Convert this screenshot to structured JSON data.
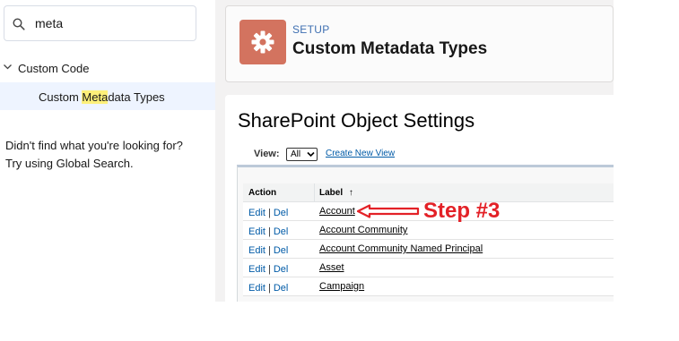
{
  "sidebar": {
    "search": {
      "value": "meta"
    },
    "tree": {
      "parent_label": "Custom Code",
      "child": {
        "before": "Custom ",
        "highlight": "Meta",
        "after": "data Types"
      }
    },
    "hint_line1": "Didn't find what you're looking for?",
    "hint_line2": "Try using Global Search."
  },
  "header": {
    "eyebrow": "SETUP",
    "title": "Custom Metadata Types"
  },
  "content": {
    "title": "SharePoint Object Settings",
    "view": {
      "label": "View:",
      "selected": "All",
      "create_link": "Create New View"
    },
    "table": {
      "headers": {
        "action": "Action",
        "label": "Label",
        "sort_glyph": "↑"
      },
      "rows": [
        {
          "edit": "Edit",
          "sep": "|",
          "del": "Del",
          "label": "Account"
        },
        {
          "edit": "Edit",
          "sep": "|",
          "del": "Del",
          "label": "Account Community"
        },
        {
          "edit": "Edit",
          "sep": "|",
          "del": "Del",
          "label": "Account Community Named Principal"
        },
        {
          "edit": "Edit",
          "sep": "|",
          "del": "Del",
          "label": "Asset"
        },
        {
          "edit": "Edit",
          "sep": "|",
          "del": "Del",
          "label": "Campaign"
        }
      ]
    }
  },
  "annotation": {
    "text": "Step #3",
    "color": "#e32127"
  },
  "colors": {
    "header_icon_bg": "#d3735f",
    "link": "#015ba7",
    "highlight": "#fdf07a",
    "selected_row_bg": "#eef4ff"
  },
  "icons": {
    "search": "search-icon",
    "chevron": "chevron-down-icon",
    "gear": "gear-icon",
    "arrow": "left-arrow-annotation"
  }
}
